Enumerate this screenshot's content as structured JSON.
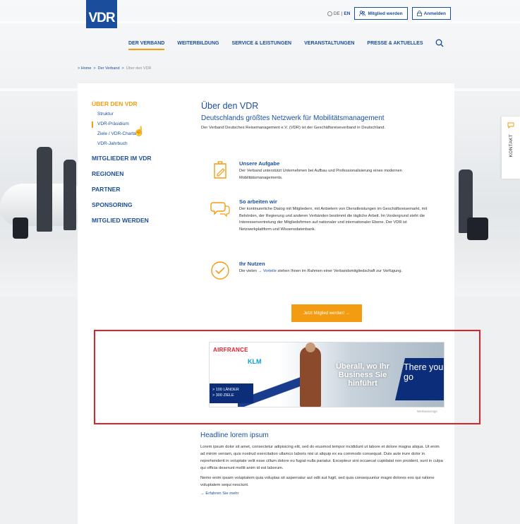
{
  "header": {
    "logo": "VDR",
    "lang_de": "DE",
    "lang_sep": "|",
    "lang_en": "EN",
    "member_button": "Mitglied werden",
    "login_button": "Anmelden"
  },
  "nav": {
    "items": [
      "DER VERBAND",
      "WEITERBILDUNG",
      "SERVICE & LEISTUNGEN",
      "VERANSTALTUNGEN",
      "PRESSE & AKTUELLES"
    ]
  },
  "breadcrumb": {
    "home": "> Home",
    "sep1": ">",
    "section": "Der Verband",
    "sep2": ">",
    "current": "Über den VDR"
  },
  "sidenav": {
    "heading": "ÜBER DEN VDR",
    "sub": [
      "Struktur",
      "VDR-Präsidium",
      "Ziele / VDR-Charta",
      "VDR-Jahrbuch"
    ],
    "sections": [
      "MITGLIEDER IM VDR",
      "REGIONEN",
      "PARTNER",
      "SPONSORING",
      "MITGLIED WERDEN"
    ]
  },
  "main": {
    "title": "Über den VDR",
    "subtitle": "Deutschlands größtes Netzwerk für Mobilitätsmanagement",
    "intro": "Der Verband Deutsches Reisemanagement e.V. (VDR) ist der Geschäftsreiseverband in Deutschland."
  },
  "features": [
    {
      "title": "Unsere Aufgabe",
      "text": "Der Verband unterstützt Unternehmen bei Aufbau und Professionalisierung eines modernen Mobilitätsmanagements."
    },
    {
      "title": "So arbeiten wir",
      "text": "Der kontinuierliche Dialog mit Mitgliedern, mit Anbietern von Dienstleistungen im Geschäftsreisemarkt, mit Behörden, der Regierung und anderen Verbänden bestimmt die tägliche Arbeit. Im Vordergrund steht die Interessenvertretung der Mitgliedsfirmen auf nationaler und internationaler Ebene. Der VDR ist Netzwerkplattform und Wissensdatenbank."
    },
    {
      "title": "Ihr Nutzen",
      "text_before": "Die vielen",
      "link": "→ Vorteile",
      "text_after": "stehen Ihnen im Rahmen einer Verbandsmitgliedschaft zur Verfügung."
    }
  ],
  "join_button": "Jetzt Mitglied werden! →",
  "ad": {
    "airfrance": "AIRFRANCE",
    "klm": "KLM",
    "dest_line1": "> 100 LÄNDER",
    "dest_line2": "> 300 ZIELE",
    "slogan": "Überall, wo Ihr Business Sie hinführt",
    "tagline": "There you go",
    "label": "Werbeanzeige"
  },
  "lorem": {
    "headline": "Headline lorem ipsum",
    "p1": "Lorem ipsum dolor sit amet, consectetur adipisicing elit, sed do eiusmod tempor incididunt ut labore et dolore magna aliqua. Ut enim ad minim veniam, quis nostrud exercitation ullamco laboris nisi ut aliquip ex ea commodo consequat. Duis aute irure dolor in reprehenderit in voluptate velit esse cillum dolore eu fugiat nulla pariatur. Excepteur sint occaecat cupidatat non proident, sunt in culpa qui officia deserunt mollit anim id est laborum.",
    "p2": "Nemo enim ipsam voluptatem quia voluptas sit aspernatur aut odit aut fugit, sed quia consequuntur magni dolores eos qui ratione voluptatem sequi nesciunt.",
    "more": "→ Erfahren Sie mehr"
  },
  "kontakt": {
    "label": "KONTAKT"
  },
  "colors": {
    "brand_blue": "#1a4e9c",
    "accent_orange": "#f39c12",
    "highlight_red": "#e0202a"
  }
}
